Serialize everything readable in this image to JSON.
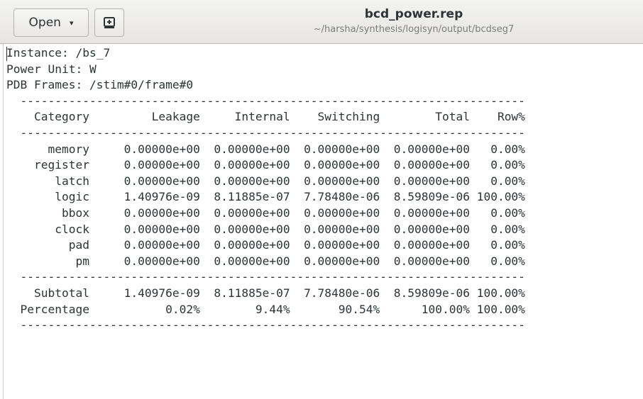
{
  "window": {
    "title": "bcd_power.rep",
    "path": "~/harsha/synthesis/logisyn/output/bcdseg7",
    "open_label": "Open",
    "open_caret": "▾",
    "new_doc_icon": "document-new-icon"
  },
  "report": {
    "lines": [
      "Instance: /bs_7",
      "Power Unit: W",
      "PDB Frames: /stim#0/frame#0",
      "  -------------------------------------------------------------------------",
      "    Category         Leakage     Internal    Switching        Total    Row%",
      "  -------------------------------------------------------------------------",
      "      memory     0.00000e+00  0.00000e+00  0.00000e+00  0.00000e+00   0.00%",
      "    register     0.00000e+00  0.00000e+00  0.00000e+00  0.00000e+00   0.00%",
      "       latch     0.00000e+00  0.00000e+00  0.00000e+00  0.00000e+00   0.00%",
      "       logic     1.40976e-09  8.11885e-07  7.78480e-06  8.59809e-06 100.00%",
      "        bbox     0.00000e+00  0.00000e+00  0.00000e+00  0.00000e+00   0.00%",
      "       clock     0.00000e+00  0.00000e+00  0.00000e+00  0.00000e+00   0.00%",
      "         pad     0.00000e+00  0.00000e+00  0.00000e+00  0.00000e+00   0.00%",
      "          pm     0.00000e+00  0.00000e+00  0.00000e+00  0.00000e+00   0.00%",
      "  -------------------------------------------------------------------------",
      "    Subtotal     1.40976e-09  8.11885e-07  7.78480e-06  8.59809e-06 100.00%",
      "  Percentage           0.02%        9.44%       90.54%      100.00% 100.00%",
      "  -------------------------------------------------------------------------"
    ]
  }
}
